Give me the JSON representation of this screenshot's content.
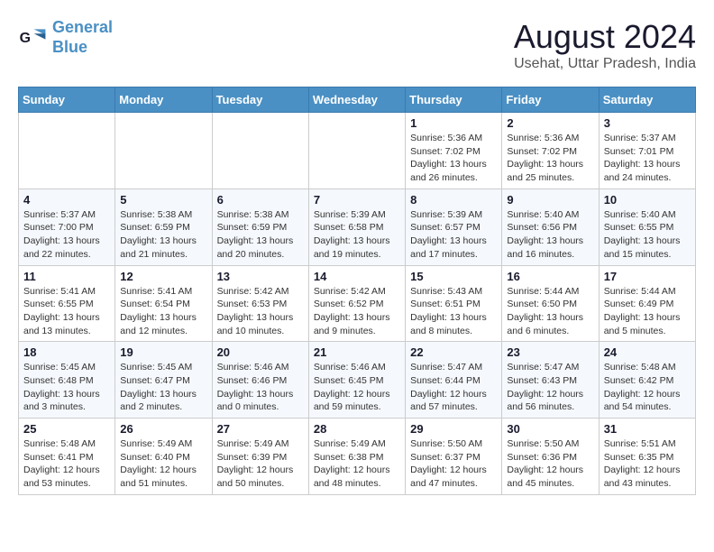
{
  "logo": {
    "line1": "General",
    "line2": "Blue"
  },
  "title": "August 2024",
  "subtitle": "Usehat, Uttar Pradesh, India",
  "weekdays": [
    "Sunday",
    "Monday",
    "Tuesday",
    "Wednesday",
    "Thursday",
    "Friday",
    "Saturday"
  ],
  "weeks": [
    [
      {
        "day": "",
        "info": ""
      },
      {
        "day": "",
        "info": ""
      },
      {
        "day": "",
        "info": ""
      },
      {
        "day": "",
        "info": ""
      },
      {
        "day": "1",
        "info": "Sunrise: 5:36 AM\nSunset: 7:02 PM\nDaylight: 13 hours\nand 26 minutes."
      },
      {
        "day": "2",
        "info": "Sunrise: 5:36 AM\nSunset: 7:02 PM\nDaylight: 13 hours\nand 25 minutes."
      },
      {
        "day": "3",
        "info": "Sunrise: 5:37 AM\nSunset: 7:01 PM\nDaylight: 13 hours\nand 24 minutes."
      }
    ],
    [
      {
        "day": "4",
        "info": "Sunrise: 5:37 AM\nSunset: 7:00 PM\nDaylight: 13 hours\nand 22 minutes."
      },
      {
        "day": "5",
        "info": "Sunrise: 5:38 AM\nSunset: 6:59 PM\nDaylight: 13 hours\nand 21 minutes."
      },
      {
        "day": "6",
        "info": "Sunrise: 5:38 AM\nSunset: 6:59 PM\nDaylight: 13 hours\nand 20 minutes."
      },
      {
        "day": "7",
        "info": "Sunrise: 5:39 AM\nSunset: 6:58 PM\nDaylight: 13 hours\nand 19 minutes."
      },
      {
        "day": "8",
        "info": "Sunrise: 5:39 AM\nSunset: 6:57 PM\nDaylight: 13 hours\nand 17 minutes."
      },
      {
        "day": "9",
        "info": "Sunrise: 5:40 AM\nSunset: 6:56 PM\nDaylight: 13 hours\nand 16 minutes."
      },
      {
        "day": "10",
        "info": "Sunrise: 5:40 AM\nSunset: 6:55 PM\nDaylight: 13 hours\nand 15 minutes."
      }
    ],
    [
      {
        "day": "11",
        "info": "Sunrise: 5:41 AM\nSunset: 6:55 PM\nDaylight: 13 hours\nand 13 minutes."
      },
      {
        "day": "12",
        "info": "Sunrise: 5:41 AM\nSunset: 6:54 PM\nDaylight: 13 hours\nand 12 minutes."
      },
      {
        "day": "13",
        "info": "Sunrise: 5:42 AM\nSunset: 6:53 PM\nDaylight: 13 hours\nand 10 minutes."
      },
      {
        "day": "14",
        "info": "Sunrise: 5:42 AM\nSunset: 6:52 PM\nDaylight: 13 hours\nand 9 minutes."
      },
      {
        "day": "15",
        "info": "Sunrise: 5:43 AM\nSunset: 6:51 PM\nDaylight: 13 hours\nand 8 minutes."
      },
      {
        "day": "16",
        "info": "Sunrise: 5:44 AM\nSunset: 6:50 PM\nDaylight: 13 hours\nand 6 minutes."
      },
      {
        "day": "17",
        "info": "Sunrise: 5:44 AM\nSunset: 6:49 PM\nDaylight: 13 hours\nand 5 minutes."
      }
    ],
    [
      {
        "day": "18",
        "info": "Sunrise: 5:45 AM\nSunset: 6:48 PM\nDaylight: 13 hours\nand 3 minutes."
      },
      {
        "day": "19",
        "info": "Sunrise: 5:45 AM\nSunset: 6:47 PM\nDaylight: 13 hours\nand 2 minutes."
      },
      {
        "day": "20",
        "info": "Sunrise: 5:46 AM\nSunset: 6:46 PM\nDaylight: 13 hours\nand 0 minutes."
      },
      {
        "day": "21",
        "info": "Sunrise: 5:46 AM\nSunset: 6:45 PM\nDaylight: 12 hours\nand 59 minutes."
      },
      {
        "day": "22",
        "info": "Sunrise: 5:47 AM\nSunset: 6:44 PM\nDaylight: 12 hours\nand 57 minutes."
      },
      {
        "day": "23",
        "info": "Sunrise: 5:47 AM\nSunset: 6:43 PM\nDaylight: 12 hours\nand 56 minutes."
      },
      {
        "day": "24",
        "info": "Sunrise: 5:48 AM\nSunset: 6:42 PM\nDaylight: 12 hours\nand 54 minutes."
      }
    ],
    [
      {
        "day": "25",
        "info": "Sunrise: 5:48 AM\nSunset: 6:41 PM\nDaylight: 12 hours\nand 53 minutes."
      },
      {
        "day": "26",
        "info": "Sunrise: 5:49 AM\nSunset: 6:40 PM\nDaylight: 12 hours\nand 51 minutes."
      },
      {
        "day": "27",
        "info": "Sunrise: 5:49 AM\nSunset: 6:39 PM\nDaylight: 12 hours\nand 50 minutes."
      },
      {
        "day": "28",
        "info": "Sunrise: 5:49 AM\nSunset: 6:38 PM\nDaylight: 12 hours\nand 48 minutes."
      },
      {
        "day": "29",
        "info": "Sunrise: 5:50 AM\nSunset: 6:37 PM\nDaylight: 12 hours\nand 47 minutes."
      },
      {
        "day": "30",
        "info": "Sunrise: 5:50 AM\nSunset: 6:36 PM\nDaylight: 12 hours\nand 45 minutes."
      },
      {
        "day": "31",
        "info": "Sunrise: 5:51 AM\nSunset: 6:35 PM\nDaylight: 12 hours\nand 43 minutes."
      }
    ]
  ]
}
